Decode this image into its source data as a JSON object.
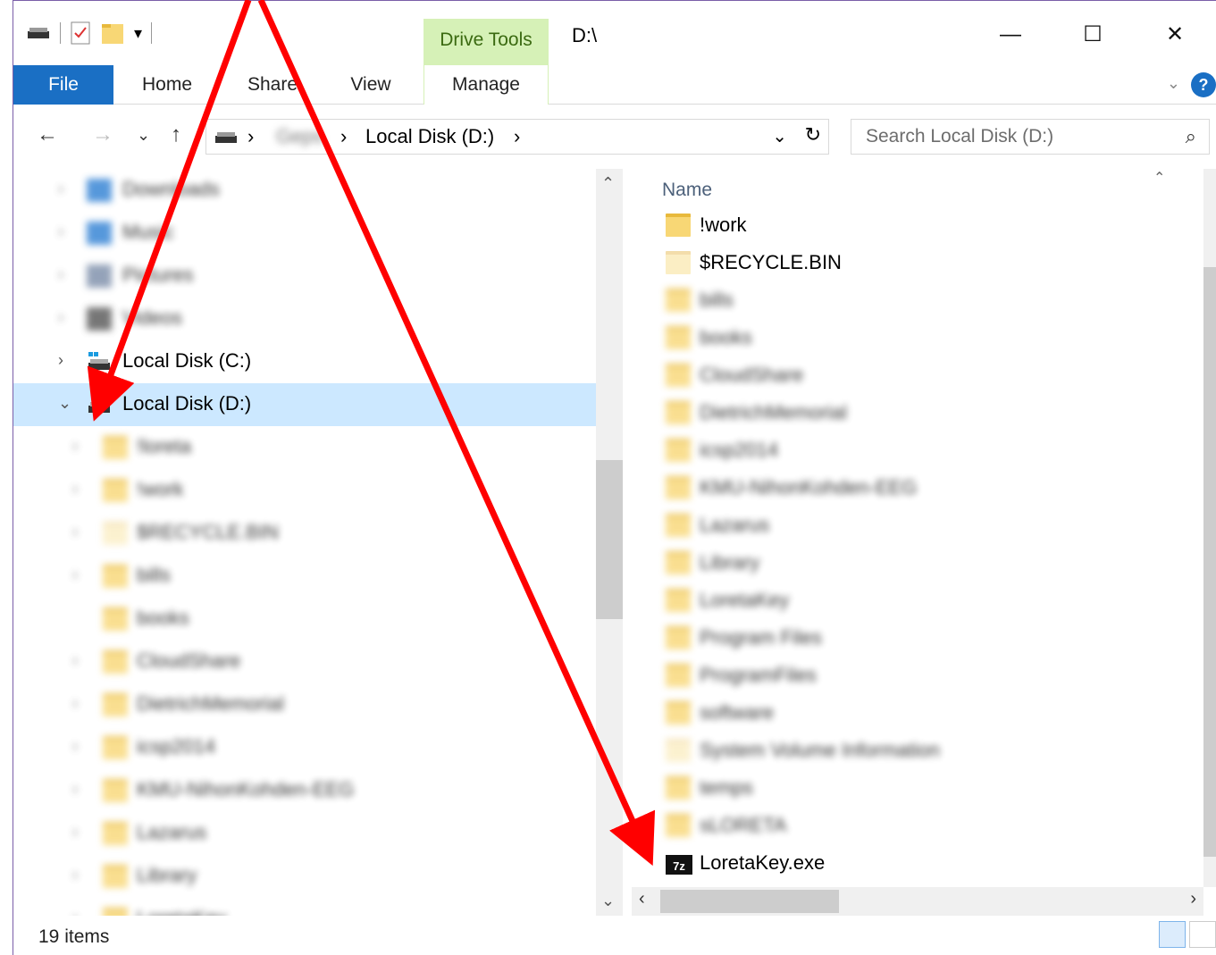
{
  "titlebar": {
    "context_tab": "Drive Tools",
    "title": "D:\\",
    "minimize": "—",
    "maximize": "☐",
    "close": "✕"
  },
  "ribbon": {
    "tabs": [
      "File",
      "Home",
      "Share",
      "View",
      "Manage"
    ],
    "help": "?"
  },
  "address": {
    "back": "←",
    "forward": "→",
    "recent": "⌄",
    "up": "↑",
    "crumbs": [
      "Geps",
      "Local Disk (D:)"
    ],
    "sep": "›",
    "search_placeholder": "Search Local Disk (D:)"
  },
  "navpane": {
    "items": [
      {
        "label": "Downloads",
        "blurred": true,
        "icon": "downloads-icon"
      },
      {
        "label": "Music",
        "blurred": true,
        "icon": "music-icon"
      },
      {
        "label": "Pictures",
        "blurred": true,
        "icon": "pictures-icon"
      },
      {
        "label": "Videos",
        "blurred": true,
        "icon": "videos-icon"
      },
      {
        "label": "Local Disk (C:)",
        "blurred": false,
        "icon": "windows-drive-icon"
      },
      {
        "label": "Local Disk (D:)",
        "blurred": false,
        "icon": "drive-icon",
        "selected": true
      },
      {
        "label": "!loreta",
        "blurred": true,
        "icon": "folder-icon"
      },
      {
        "label": "!work",
        "blurred": true,
        "icon": "folder-icon"
      },
      {
        "label": "$RECYCLE.BIN",
        "blurred": true,
        "icon": "folder-icon"
      },
      {
        "label": "bills",
        "blurred": true,
        "icon": "folder-icon"
      },
      {
        "label": "books",
        "blurred": true,
        "icon": "folder-icon"
      },
      {
        "label": "CloudShare",
        "blurred": true,
        "icon": "folder-icon"
      },
      {
        "label": "DietrichMemorial",
        "blurred": true,
        "icon": "folder-icon"
      },
      {
        "label": "icsp2014",
        "blurred": true,
        "icon": "folder-icon"
      },
      {
        "label": "KMU-NihonKohden-EEG",
        "blurred": true,
        "icon": "folder-icon"
      },
      {
        "label": "Lazarus",
        "blurred": true,
        "icon": "folder-icon"
      },
      {
        "label": "Library",
        "blurred": true,
        "icon": "folder-icon"
      },
      {
        "label": "LoretaKey",
        "blurred": true,
        "icon": "folder-icon"
      }
    ]
  },
  "filepane": {
    "column_name": "Name",
    "items": [
      {
        "label": "!work",
        "blurred": false,
        "icon": "folder-icon"
      },
      {
        "label": "$RECYCLE.BIN",
        "blurred": false,
        "icon": "folder-icon"
      },
      {
        "label": "bills",
        "blurred": true,
        "icon": "folder-icon"
      },
      {
        "label": "books",
        "blurred": true,
        "icon": "folder-icon"
      },
      {
        "label": "CloudShare",
        "blurred": true,
        "icon": "folder-icon"
      },
      {
        "label": "DietrichMemorial",
        "blurred": true,
        "icon": "folder-icon"
      },
      {
        "label": "icsp2014",
        "blurred": true,
        "icon": "folder-icon"
      },
      {
        "label": "KMU-NihonKohden-EEG",
        "blurred": true,
        "icon": "folder-icon"
      },
      {
        "label": "Lazarus",
        "blurred": true,
        "icon": "folder-icon"
      },
      {
        "label": "Library",
        "blurred": true,
        "icon": "folder-icon"
      },
      {
        "label": "LoretaKey",
        "blurred": true,
        "icon": "folder-icon"
      },
      {
        "label": "Program Files",
        "blurred": true,
        "icon": "folder-icon"
      },
      {
        "label": "ProgramFiles",
        "blurred": true,
        "icon": "folder-icon"
      },
      {
        "label": "software",
        "blurred": true,
        "icon": "folder-icon"
      },
      {
        "label": "System Volume Information",
        "blurred": true,
        "icon": "folder-icon"
      },
      {
        "label": "temps",
        "blurred": true,
        "icon": "folder-icon"
      },
      {
        "label": "sLORETA",
        "blurred": true,
        "icon": "folder-icon"
      },
      {
        "label": "LoretaKey.exe",
        "blurred": false,
        "icon": "7zip-exe-icon"
      }
    ]
  },
  "status": {
    "count": "19 items"
  },
  "colors": {
    "accent": "#1a6fc4",
    "selection": "#cce8ff",
    "context_tab": "#d6f1b7",
    "annotation": "#ff0000"
  }
}
